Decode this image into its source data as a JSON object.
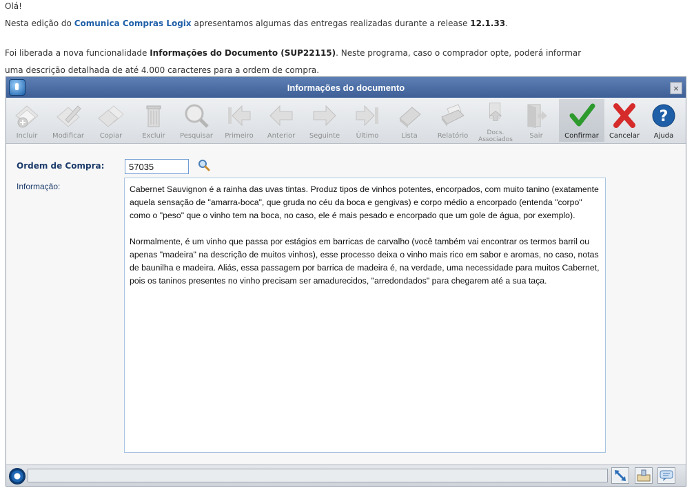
{
  "intro": {
    "greeting": "Olá!",
    "line2_prefix": "Nesta edição do ",
    "line2_brand": "Comunica Compras Logix",
    "line2_mid": " apresentamos algumas das entregas realizadas durante a release ",
    "line2_release": "12.1.33",
    "line2_suffix": ".",
    "line3_prefix": "Foi liberada a nova funcionalidade ",
    "line3_feature": "Informações do Documento (SUP22115)",
    "line3_suffix": ". Neste programa, caso o comprador opte, poderá informar",
    "line4": "uma descrição detalhada de até 4.000 caracteres para a ordem de compra."
  },
  "window": {
    "title": "Informações do documento",
    "close": "×"
  },
  "toolbar": {
    "incluir": "Incluir",
    "modificar": "Modificar",
    "copiar": "Copiar",
    "excluir": "Excluir",
    "pesquisar": "Pesquisar",
    "primeiro": "Primeiro",
    "anterior": "Anterior",
    "seguinte": "Seguinte",
    "ultimo": "Último",
    "lista": "Lista",
    "relatorio": "Relatório",
    "docs_1": "Docs.",
    "docs_2": "Associados",
    "sair": "Sair",
    "confirmar": "Confirmar",
    "cancelar": "Cancelar",
    "ajuda": "Ajuda"
  },
  "form": {
    "ordem_label": "Ordem de Compra:",
    "ordem_value": "57035",
    "info_label": "Informação:",
    "info_p1": "Cabernet Sauvignon é a rainha das uvas tintas. Produz tipos de vinhos potentes, encorpados, com muito tanino (exatamente aquela sensação de \"amarra-boca\", que gruda no céu da boca e gengivas) e corpo médio a encorpado (entenda \"corpo\" como o \"peso\" que o vinho tem na boca, no caso, ele é mais pesado e encorpado que um gole de água, por exemplo).",
    "info_p2": "Normalmente, é um vinho que passa por estágios em barricas de carvalho (você também vai encontrar os termos barril ou apenas \"madeira\" na descrição de muitos vinhos), esse processo deixa o vinho mais rico em sabor e aromas, no caso, notas de baunilha e madeira. Aliás, essa passagem por barrica de madeira é, na verdade, uma necessidade para muitos Cabernet, pois os taninos presentes no vinho precisam ser amadurecidos, \"arredondados\" para chegarem até a sua taça."
  },
  "colors": {
    "title_bar": "#4a6ea8",
    "brand_link": "#1f5fa8",
    "confirm": "#2e9a2e",
    "cancel": "#d62b2b",
    "help": "#1f5fa8"
  }
}
